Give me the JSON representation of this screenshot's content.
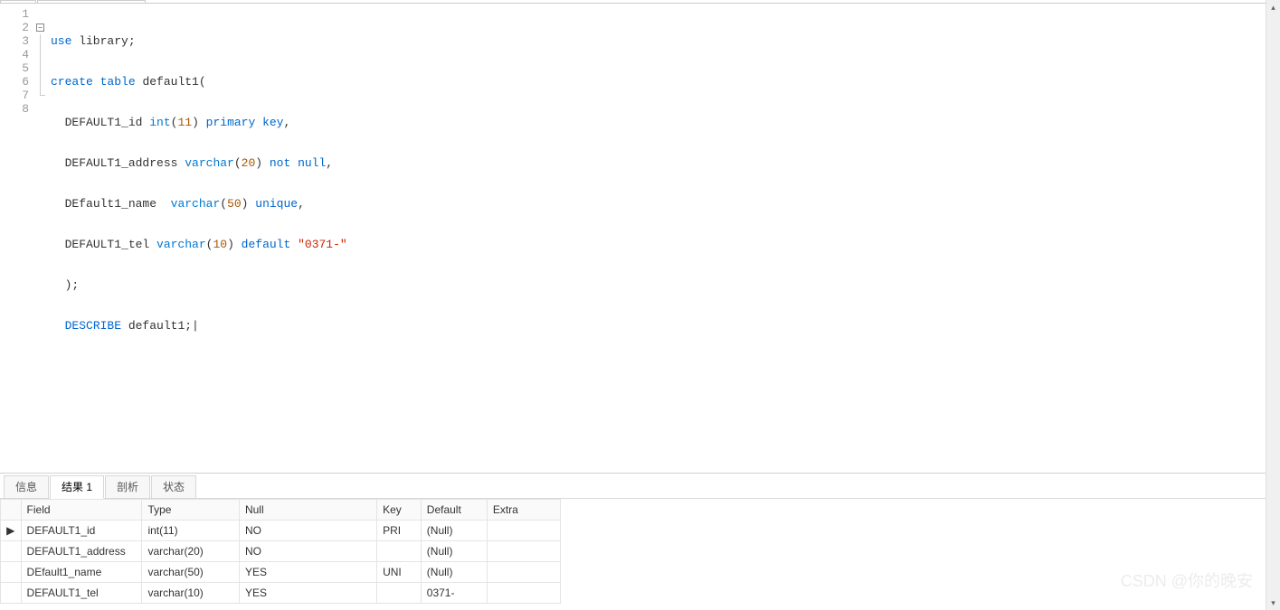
{
  "editor": {
    "lines": [
      {
        "n": "1",
        "fold": "none"
      },
      {
        "n": "2",
        "fold": "open"
      },
      {
        "n": "3",
        "fold": "line"
      },
      {
        "n": "4",
        "fold": "line"
      },
      {
        "n": "5",
        "fold": "line"
      },
      {
        "n": "6",
        "fold": "line"
      },
      {
        "n": "7",
        "fold": "end"
      },
      {
        "n": "8",
        "fold": "none"
      }
    ],
    "code": {
      "l1": {
        "kw1": "use",
        "id": " library;"
      },
      "l2": {
        "kw1": "create",
        "kw2": "table",
        "id": " default1("
      },
      "l3": {
        "indent": "  ",
        "col": "DEFAULT1_id ",
        "typ": "int",
        "paren_o": "(",
        "num": "11",
        "paren_c": ") ",
        "kw": "primary key",
        "comma": ","
      },
      "l4": {
        "indent": "  ",
        "col": "DEFAULT1_address ",
        "typ": "varchar",
        "paren_o": "(",
        "num": "20",
        "paren_c": ") ",
        "kw": "not null",
        "comma": ","
      },
      "l5": {
        "indent": "  ",
        "col": "DEfault1_name  ",
        "typ": "varchar",
        "paren_o": "(",
        "num": "50",
        "paren_c": ") ",
        "kw": "unique",
        "comma": ","
      },
      "l6": {
        "indent": "  ",
        "col": "DEFAULT1_tel ",
        "typ": "varchar",
        "paren_o": "(",
        "num": "10",
        "paren_c": ") ",
        "kw": "default",
        "sp": " ",
        "str": "\"0371-\""
      },
      "l7": {
        "indent": "  ",
        "text": ");"
      },
      "l8": {
        "indent": "  ",
        "kw": "DESCRIBE",
        "id": " default1;|"
      }
    }
  },
  "tabs": {
    "info": "信息",
    "result": "结果 1",
    "profile": "剖析",
    "status": "状态"
  },
  "grid": {
    "headers": {
      "field": "Field",
      "type": "Type",
      "null": "Null",
      "key": "Key",
      "default": "Default",
      "extra": "Extra"
    },
    "null_text": "(Null)",
    "rows": [
      {
        "indicator": "▶",
        "field": "DEFAULT1_id",
        "type": "int(11)",
        "nul": "NO",
        "key": "PRI",
        "def": null,
        "extra": ""
      },
      {
        "indicator": "",
        "field": "DEFAULT1_address",
        "type": "varchar(20)",
        "nul": "NO",
        "key": "",
        "def": null,
        "extra": ""
      },
      {
        "indicator": "",
        "field": "DEfault1_name",
        "type": "varchar(50)",
        "nul": "YES",
        "key": "UNI",
        "def": null,
        "extra": ""
      },
      {
        "indicator": "",
        "field": "DEFAULT1_tel",
        "type": "varchar(10)",
        "nul": "YES",
        "key": "",
        "def": "0371-",
        "extra": ""
      }
    ]
  },
  "watermark": "CSDN @你的晚安"
}
